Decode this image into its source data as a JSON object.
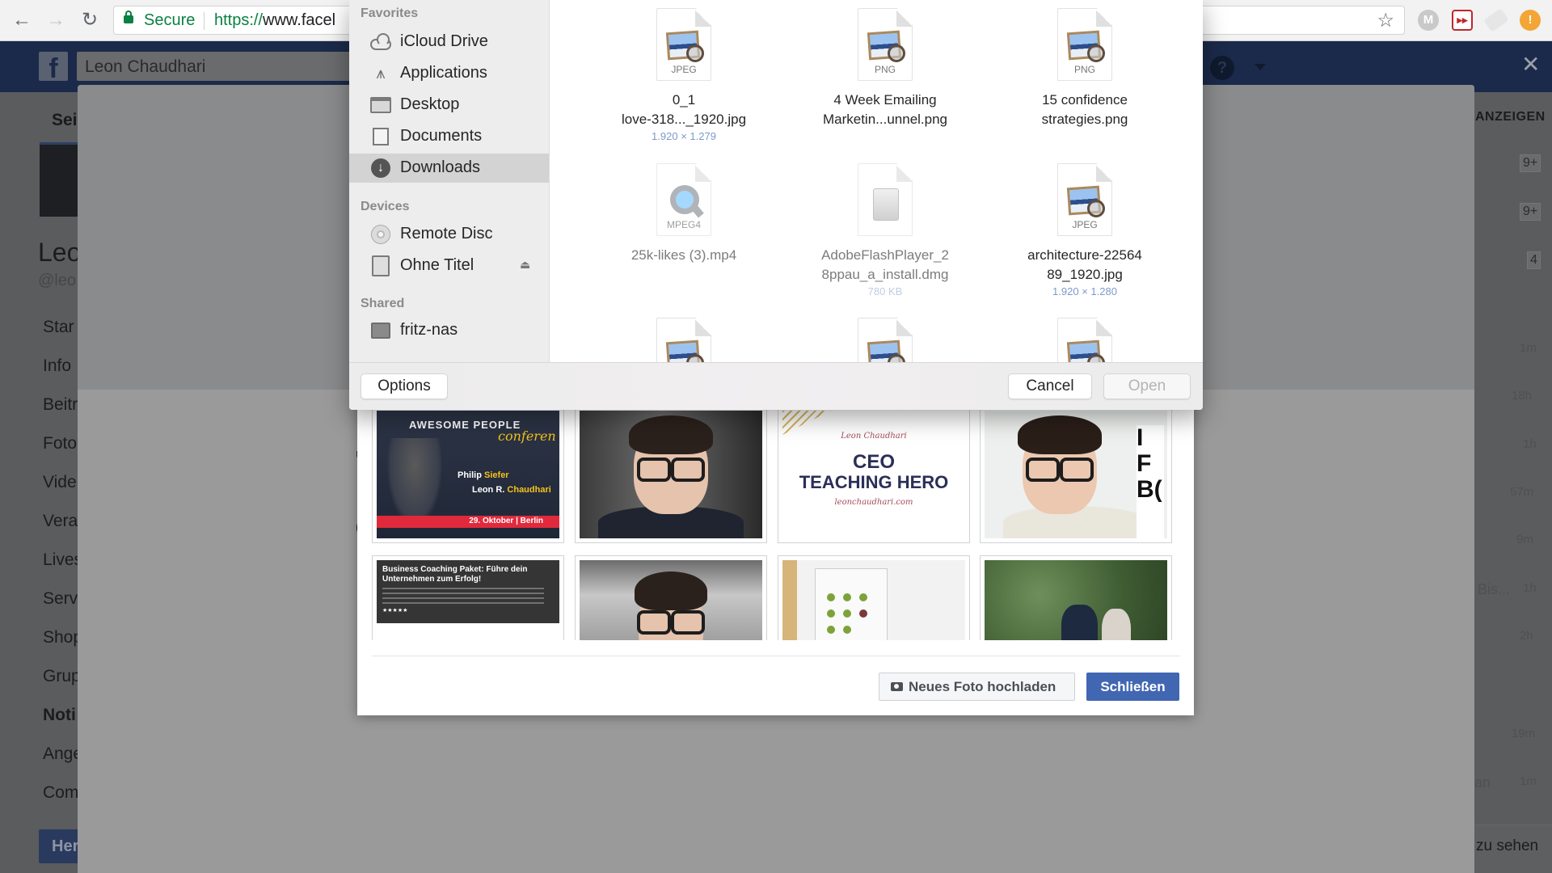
{
  "browser": {
    "security_label": "Secure",
    "url_scheme": "https://",
    "url_host": "www.facel",
    "nav": {
      "back_icon": "arrow-left",
      "forward_icon": "arrow-right",
      "reload_icon": "reload"
    },
    "extensions": [
      "mega-extension",
      "fast-forward-extension",
      "tag-extension",
      "alert-extension"
    ],
    "extension_glyphs": {
      "mega": "M",
      "ff": "▸▸",
      "alert": "!"
    }
  },
  "facebook_bar": {
    "logo": "f",
    "search_value": "Leon Chaudhari",
    "help_glyph": "?",
    "close_glyph": "✕"
  },
  "background_page": {
    "tab_fragment": "Sei",
    "profile_name_fragment": "Leo",
    "handle_fragment": "@leo",
    "nav_fragments": [
      "Star",
      "Info",
      "Beitr",
      "Foto",
      "Vide",
      "Vera",
      "Lives",
      "Serv",
      "Shop",
      "Grup",
      "Noti",
      "Ange",
      "Com"
    ],
    "active_nav_index": 10,
    "button_fragment": "Her",
    "right_header": "ANZEIGEN",
    "badges": [
      "9+",
      "9+",
      "4"
    ],
    "timestamps": [
      "1m",
      "18h",
      "1h",
      "57m",
      "9m",
      "1h",
      "2h",
      "19m",
      "1m"
    ],
    "right_text_fragments": [
      "Bis...",
      "an"
    ],
    "right_footer": "zu sehen"
  },
  "open_dialog": {
    "sidebar": {
      "sections": [
        {
          "heading": "Favorites",
          "items": [
            {
              "label": "iCloud Drive",
              "icon": "cloud-icon"
            },
            {
              "label": "Applications",
              "icon": "applications-icon"
            },
            {
              "label": "Desktop",
              "icon": "desktop-icon"
            },
            {
              "label": "Documents",
              "icon": "documents-icon"
            },
            {
              "label": "Downloads",
              "icon": "downloads-icon",
              "selected": true
            }
          ]
        },
        {
          "heading": "Devices",
          "items": [
            {
              "label": "Remote Disc",
              "icon": "disc-icon"
            },
            {
              "label": "Ohne Titel",
              "icon": "drive-icon",
              "eject": "⏏"
            }
          ]
        },
        {
          "heading": "Shared",
          "items": [
            {
              "label": "fritz-nas",
              "icon": "network-computer-icon"
            }
          ]
        }
      ]
    },
    "files": [
      {
        "name_line1": "0_1",
        "name_line2": "love-318..._1920.jpg",
        "type": "JPEG",
        "meta": "1.920 × 1.279"
      },
      {
        "name_line1": "4 Week Emailing",
        "name_line2": "Marketin...unnel.png",
        "type": "PNG",
        "meta": ""
      },
      {
        "name_line1": "15 confidence",
        "name_line2": "strategies.png",
        "type": "PNG",
        "meta": ""
      },
      {
        "name_line1": "25k-likes (3).mp4",
        "name_line2": "",
        "type": "MPEG4",
        "meta": "",
        "disabled": true
      },
      {
        "name_line1": "AdobeFlashPlayer_2",
        "name_line2": "8ppau_a_install.dmg",
        "type": "",
        "meta": "780 KB",
        "disabled": true
      },
      {
        "name_line1": "architecture-22564",
        "name_line2": "89_1920.jpg",
        "type": "JPEG",
        "meta": "1.920 × 1.280"
      },
      {
        "name_line1": "",
        "name_line2": "",
        "type": "",
        "meta": ""
      },
      {
        "name_line1": "",
        "name_line2": "",
        "type": "",
        "meta": ""
      },
      {
        "name_line1": "",
        "name_line2": "",
        "type": "",
        "meta": ""
      }
    ],
    "buttons": {
      "options": "Options",
      "cancel": "Cancel",
      "open": "Open"
    }
  },
  "photo_modal": {
    "photos": [
      {
        "kind": "conference-banner",
        "title": "AWESOME PEOPLE",
        "title_script": "conferen",
        "name1_first": "Philip",
        "name1_last": "Siefer",
        "name2_first": "Leon R.",
        "name2_last": "Chaudhari",
        "date": "29. Oktober | Berlin"
      },
      {
        "kind": "portrait"
      },
      {
        "kind": "text-card",
        "byline": "Leon Chaudhari",
        "line1": "CEO",
        "line2": "TEACHING HERO",
        "url": "leonchaudhari.com"
      },
      {
        "kind": "portrait-with-text",
        "side_text": "I\nF\nBC"
      },
      {
        "kind": "course-screenshot",
        "title": "Business Coaching Paket: Führe dein Unternehmen zum Erfolg!",
        "stars": "★★★★★"
      },
      {
        "kind": "office-portrait"
      },
      {
        "kind": "flipchart"
      },
      {
        "kind": "park-couple"
      }
    ],
    "buttons": {
      "upload": "Neues Foto hochladen",
      "close": "Schließen"
    },
    "colors": {
      "primary": "#4267b2"
    }
  }
}
